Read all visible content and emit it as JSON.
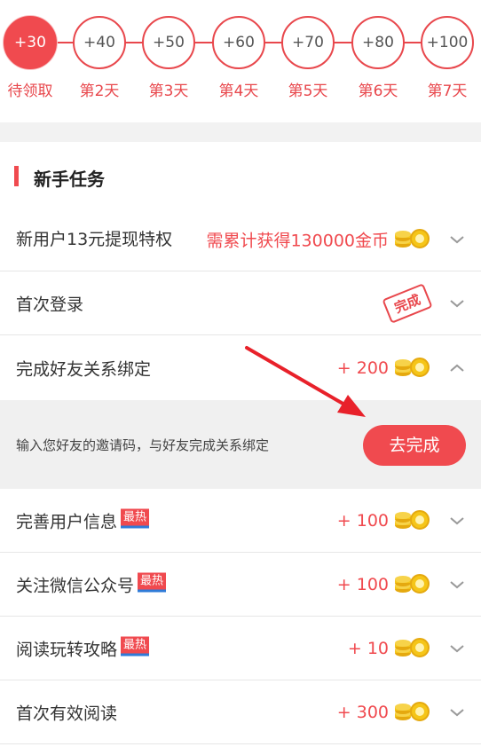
{
  "checkin": {
    "days": [
      {
        "reward": "+30",
        "label": "待领取",
        "active": true
      },
      {
        "reward": "+40",
        "label": "第2天",
        "active": false
      },
      {
        "reward": "+50",
        "label": "第3天",
        "active": false
      },
      {
        "reward": "+60",
        "label": "第4天",
        "active": false
      },
      {
        "reward": "+70",
        "label": "第5天",
        "active": false
      },
      {
        "reward": "+80",
        "label": "第6天",
        "active": false
      },
      {
        "reward": "+100",
        "label": "第7天",
        "active": false
      }
    ]
  },
  "section": {
    "title": "新手任务"
  },
  "tasks": [
    {
      "name": "新用户13元提现特权",
      "reward": "需累计获得130000金币",
      "icon": "coins-icon",
      "expanded": false
    },
    {
      "name": "首次登录",
      "stamp": "完成",
      "expanded": false
    },
    {
      "name": "完成好友关系绑定",
      "reward": "+ 200",
      "icon": "coins-icon",
      "expanded": true
    },
    {
      "name": "完善用户信息",
      "badge": "最热",
      "reward": "+ 100",
      "icon": "coins-icon",
      "expanded": false
    },
    {
      "name": "关注微信公众号",
      "badge": "最热",
      "reward": "+ 100",
      "icon": "coins-icon",
      "expanded": false
    },
    {
      "name": "阅读玩转攻略",
      "badge": "最热",
      "reward": "+ 10",
      "icon": "coins-icon",
      "expanded": false
    },
    {
      "name": "首次有效阅读",
      "reward": "+ 300",
      "icon": "coins-icon",
      "expanded": false
    }
  ],
  "detail": {
    "description": "输入您好友的邀请码，与好友完成关系绑定",
    "button_label": "去完成"
  },
  "colors": {
    "accent": "#f04a4f",
    "badge_underline": "#2f7bd8",
    "coin": "#f5c518"
  }
}
